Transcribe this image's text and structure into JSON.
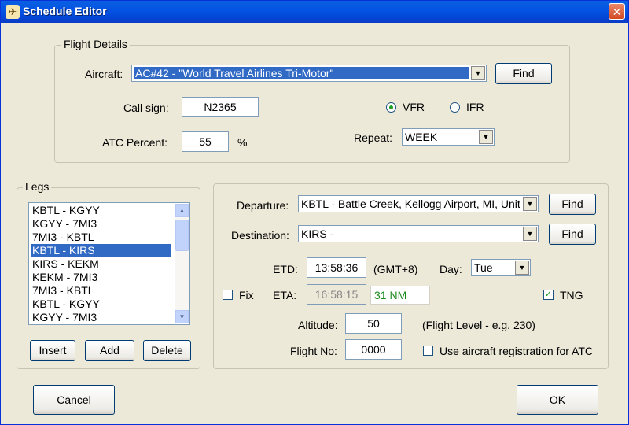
{
  "window": {
    "title": "Schedule Editor",
    "close_glyph": "✕"
  },
  "flight_details": {
    "legend": "Flight Details",
    "aircraft_label": "Aircraft:",
    "aircraft_value": "AC#42 - \"World Travel Airlines Tri-Motor\"",
    "find_label": "Find",
    "callsign_label": "Call sign:",
    "callsign_value": "N2365",
    "atc_label": "ATC Percent:",
    "atc_value": "55",
    "atc_unit": "%",
    "vfr_label": "VFR",
    "ifr_label": "IFR",
    "flight_rule_selected": "VFR",
    "repeat_label": "Repeat:",
    "repeat_value": "WEEK"
  },
  "legs": {
    "legend": "Legs",
    "items": [
      "KBTL - KGYY",
      "KGYY - 7MI3",
      "7MI3 - KBTL",
      "KBTL - KIRS",
      "KIRS - KEKM",
      "KEKM - 7MI3",
      "7MI3 - KBTL",
      "KBTL - KGYY",
      "KGYY - 7MI3"
    ],
    "selected_index": 3,
    "insert_label": "Insert",
    "add_label": "Add",
    "delete_label": "Delete"
  },
  "leg_details": {
    "departure_label": "Departure:",
    "departure_value": "KBTL - Battle Creek, Kellogg Airport, MI, Unit",
    "destination_label": "Destination:",
    "destination_value": "KIRS -",
    "find_label": "Find",
    "etd_label": "ETD:",
    "etd_value": "13:58:36",
    "tz_label": "(GMT+8)",
    "day_label": "Day:",
    "day_value": "Tue",
    "fix_label": "Fix",
    "fix_checked": false,
    "eta_label": "ETA:",
    "eta_value": "16:58:15",
    "distance_value": "31 NM",
    "tng_label": "TNG",
    "tng_checked": true,
    "altitude_label": "Altitude:",
    "altitude_value": "50",
    "altitude_hint": "(Flight Level - e.g. 230)",
    "flightno_label": "Flight No:",
    "flightno_value": "0000",
    "use_reg_label": "Use aircraft registration for ATC",
    "use_reg_checked": false
  },
  "footer": {
    "cancel_label": "Cancel",
    "ok_label": "OK"
  },
  "colors": {
    "title_bar": "#0455E4",
    "selection": "#316AC5",
    "window_bg": "#ECE9D8",
    "distance_text": "#1E8A1E"
  }
}
